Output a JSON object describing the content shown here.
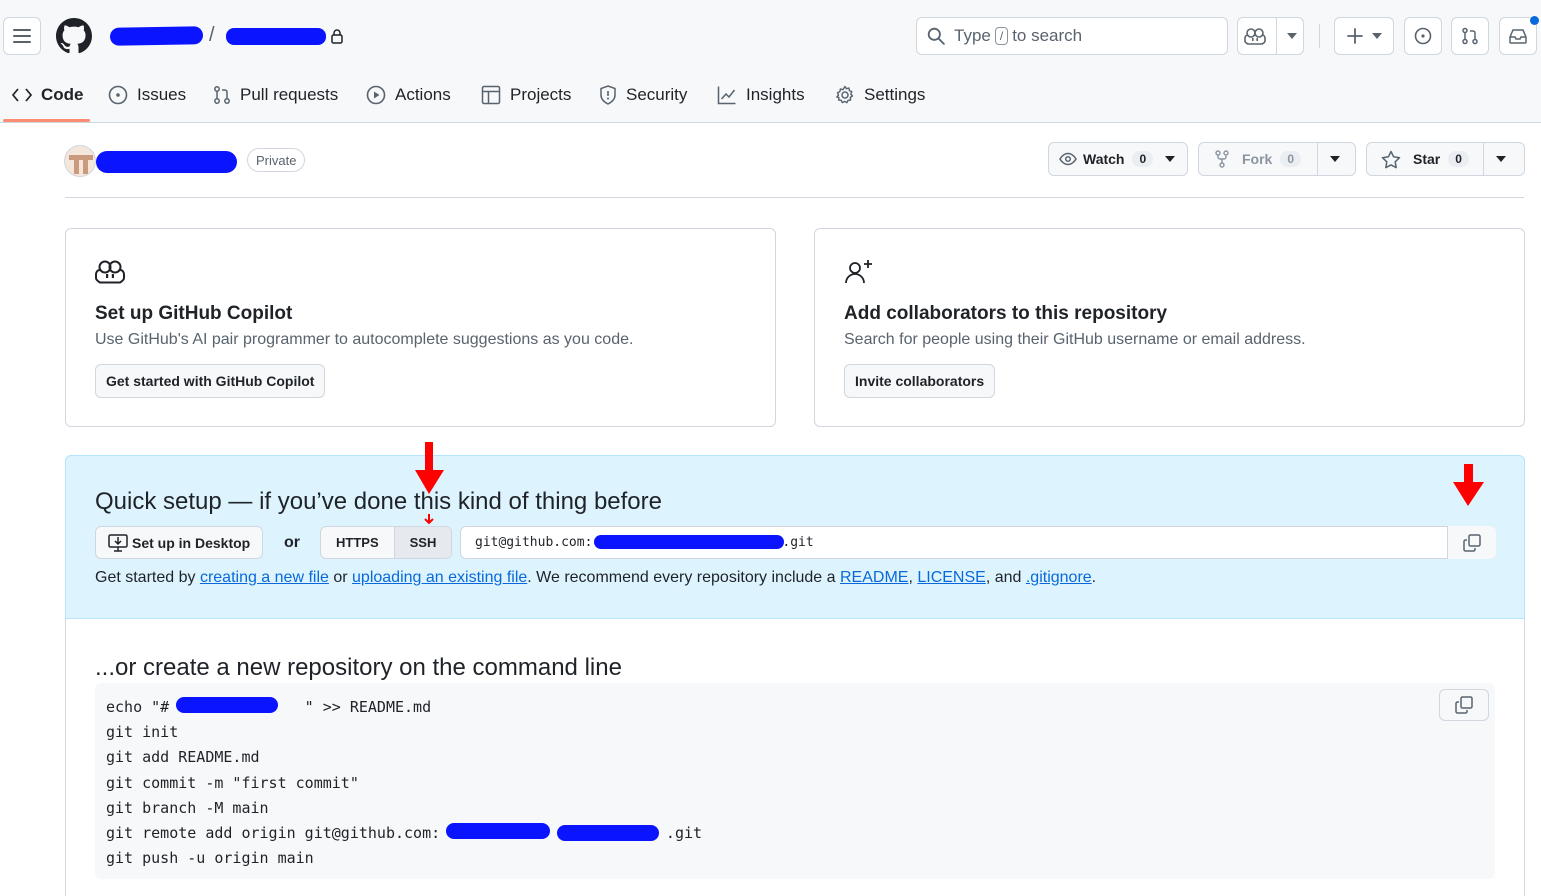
{
  "header": {
    "path_separator": "/",
    "search_prefix": "Type",
    "search_key": "/",
    "search_suffix": "to search"
  },
  "nav": {
    "items": [
      {
        "label": "Code",
        "icon": "code-icon"
      },
      {
        "label": "Issues",
        "icon": "issue-icon"
      },
      {
        "label": "Pull requests",
        "icon": "pull-request-icon"
      },
      {
        "label": "Actions",
        "icon": "play-icon"
      },
      {
        "label": "Projects",
        "icon": "table-icon"
      },
      {
        "label": "Security",
        "icon": "shield-icon"
      },
      {
        "label": "Insights",
        "icon": "graph-icon"
      },
      {
        "label": "Settings",
        "icon": "gear-icon"
      }
    ]
  },
  "repo": {
    "visibility": "Private",
    "watch": {
      "label": "Watch",
      "count": "0"
    },
    "fork": {
      "label": "Fork",
      "count": "0"
    },
    "star": {
      "label": "Star",
      "count": "0"
    }
  },
  "cards": {
    "copilot": {
      "title": "Set up GitHub Copilot",
      "description": "Use GitHub's AI pair programmer to autocomplete suggestions as you code.",
      "button": "Get started with GitHub Copilot"
    },
    "collaborators": {
      "title": "Add collaborators to this repository",
      "description": "Search for people using their GitHub username or email address.",
      "button": "Invite collaborators"
    }
  },
  "quick_setup": {
    "title": "Quick setup — if you’ve done this kind of thing before",
    "desktop_button": "Set up in Desktop",
    "or": "or",
    "protocols": [
      "HTTPS",
      "SSH"
    ],
    "selected_protocol": "SSH",
    "url_prefix": "git@github.com:",
    "url_suffix": ".git",
    "text_start": "Get started by ",
    "link_new_file": "creating a new file",
    "text_or": " or ",
    "link_upload": "uploading an existing file",
    "text_recommend": ". We recommend every repository include a ",
    "link_readme": "README",
    "text_comma1": ", ",
    "link_license": "LICENSE",
    "text_and": ", and ",
    "link_gitignore": ".gitignore",
    "text_end": "."
  },
  "command_line": {
    "title": "...or create a new repository on the command line",
    "lines": [
      "echo \"#               \" >> README.md",
      "git init",
      "git add README.md",
      "git commit -m \"first commit\"",
      "git branch -M main",
      "git remote add origin git@github.com:                         .git",
      "git push -u origin main"
    ]
  },
  "colors": {
    "accent": "#0969da",
    "nav_underline": "#fd8c73",
    "quick_setup_bg": "#ddf4ff",
    "redaction": "#0a14ff",
    "annotation_arrow": "#ff0000"
  }
}
